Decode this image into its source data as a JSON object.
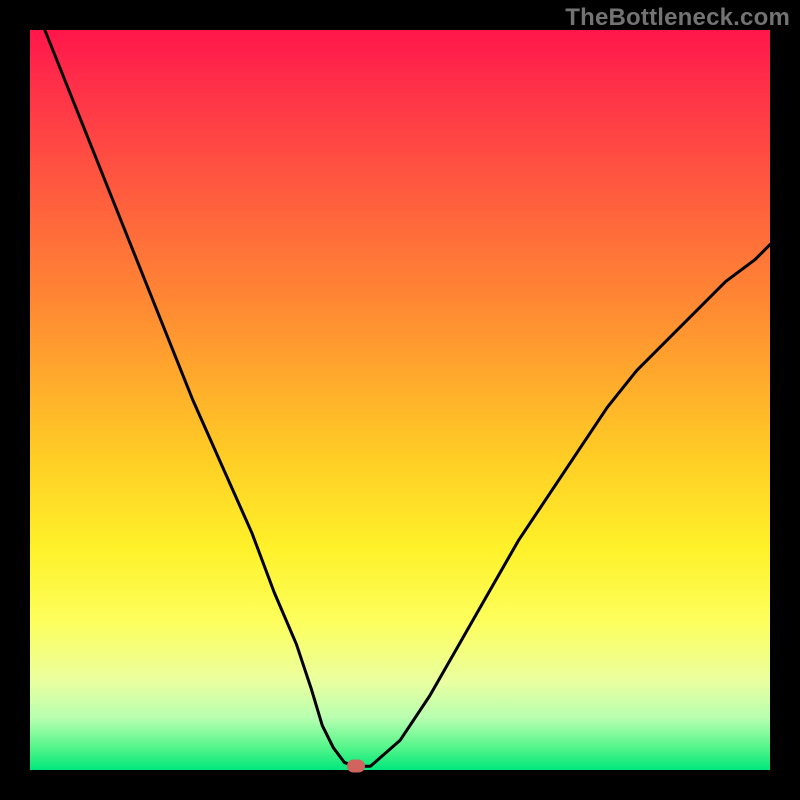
{
  "watermark": "TheBottleneck.com",
  "colors": {
    "frame_bg": "#000000",
    "curve_stroke": "#000000",
    "marker_fill": "#d1645e",
    "gradient_stops": [
      "#ff164a",
      "#ff5640",
      "#ff8c32",
      "#ffce25",
      "#fff12a",
      "#fdff5d",
      "#eaffa0",
      "#53f58a",
      "#00e77c"
    ]
  },
  "chart_data": {
    "type": "line",
    "title": "",
    "xlabel": "",
    "ylabel": "",
    "xlim": [
      0,
      100
    ],
    "ylim": [
      0,
      100
    ],
    "x": [
      2,
      6,
      10,
      14,
      18,
      22,
      26,
      30,
      33,
      36,
      38,
      39.5,
      41,
      42.5,
      44,
      46,
      50,
      54,
      58,
      62,
      66,
      70,
      74,
      78,
      82,
      86,
      90,
      94,
      98,
      100
    ],
    "y": [
      100,
      90,
      80,
      70,
      60,
      50,
      41,
      32,
      24,
      17,
      11,
      6,
      3,
      1,
      0.5,
      0.5,
      4,
      10,
      17,
      24,
      31,
      37,
      43,
      49,
      54,
      58,
      62,
      66,
      69,
      71
    ],
    "series": [
      {
        "name": "bottleneck-curve",
        "stroke": "#000000"
      }
    ],
    "marker": {
      "x": 44,
      "y": 0.5
    },
    "annotations": []
  }
}
